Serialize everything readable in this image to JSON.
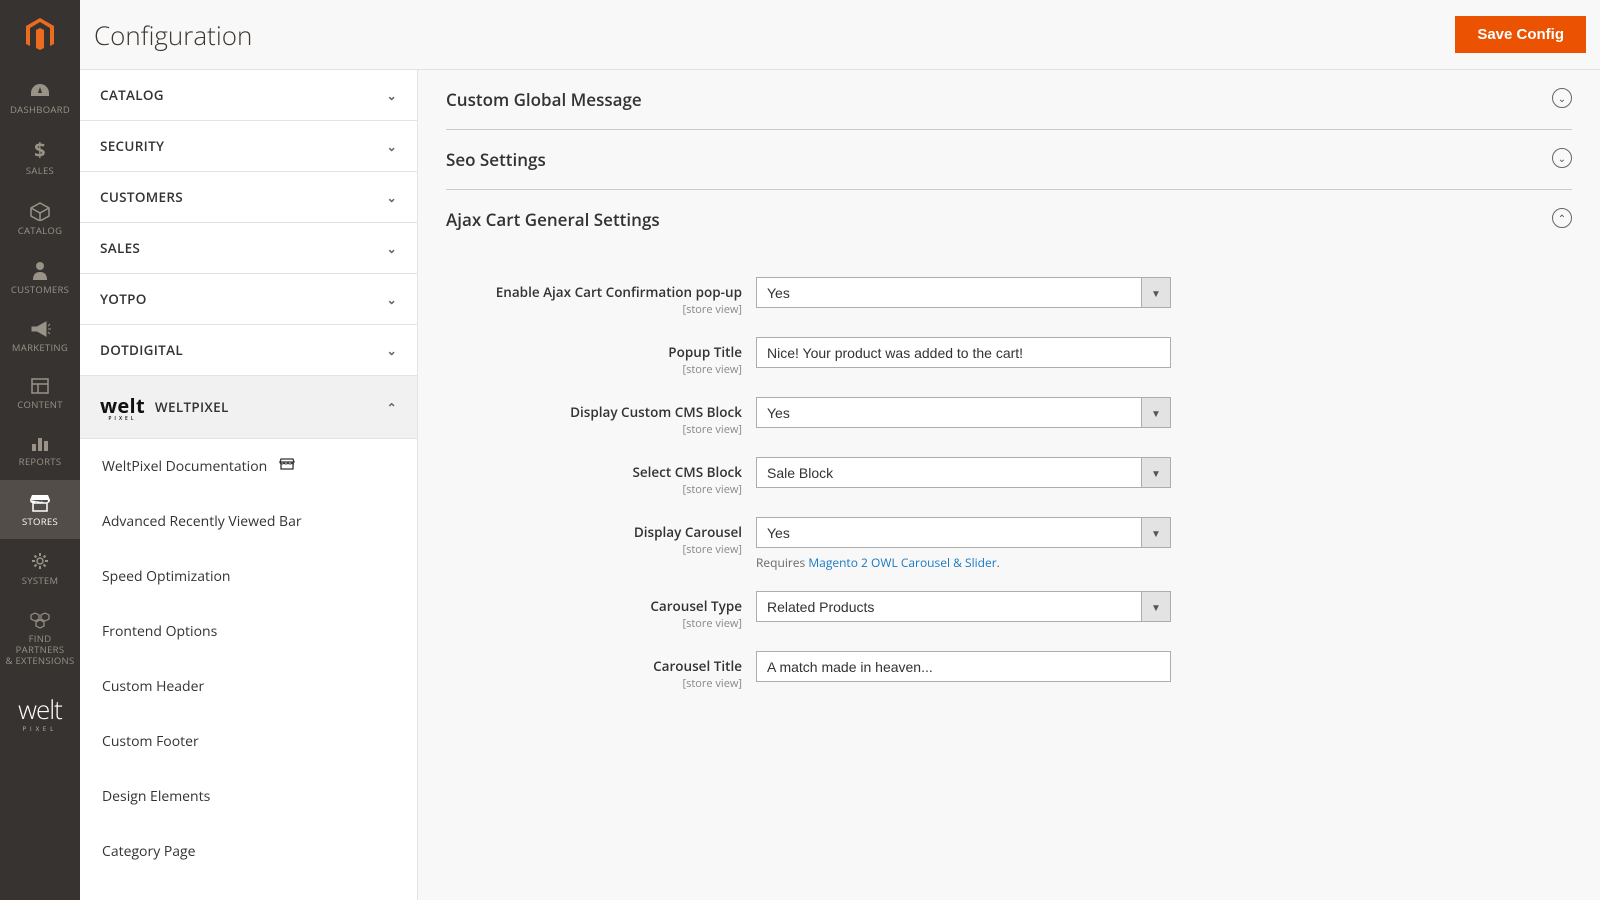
{
  "header": {
    "title": "Configuration",
    "save_label": "Save Config"
  },
  "admin_nav": {
    "items": [
      {
        "label": "DASHBOARD",
        "icon": "dashboard"
      },
      {
        "label": "SALES",
        "icon": "dollar"
      },
      {
        "label": "CATALOG",
        "icon": "cube"
      },
      {
        "label": "CUSTOMERS",
        "icon": "person"
      },
      {
        "label": "MARKETING",
        "icon": "megaphone"
      },
      {
        "label": "CONTENT",
        "icon": "blocks"
      },
      {
        "label": "REPORTS",
        "icon": "bars"
      },
      {
        "label": "STORES",
        "icon": "store",
        "active": true
      },
      {
        "label": "SYSTEM",
        "icon": "gear"
      },
      {
        "label": "FIND PARTNERS\n& EXTENSIONS",
        "icon": "boxes"
      }
    ]
  },
  "config_tabs": {
    "sections": [
      {
        "label": "CATALOG"
      },
      {
        "label": "SECURITY"
      },
      {
        "label": "CUSTOMERS"
      },
      {
        "label": "SALES"
      },
      {
        "label": "YOTPO"
      },
      {
        "label": "DOTDIGITAL"
      }
    ],
    "welt_section": "WELTPIXEL",
    "welt_items": [
      {
        "label": "WeltPixel Documentation",
        "has_icon": true
      },
      {
        "label": "Advanced Recently Viewed Bar"
      },
      {
        "label": "Speed Optimization"
      },
      {
        "label": "Frontend Options"
      },
      {
        "label": "Custom Header"
      },
      {
        "label": "Custom Footer"
      },
      {
        "label": "Design Elements"
      },
      {
        "label": "Category Page"
      }
    ]
  },
  "fieldsets": {
    "custom_message": "Custom Global Message",
    "seo": "Seo Settings",
    "ajax": "Ajax Cart General Settings"
  },
  "fields": {
    "enable_popup": {
      "label": "Enable Ajax Cart Confirmation pop-up",
      "scope": "[store view]",
      "value": "Yes"
    },
    "popup_title": {
      "label": "Popup Title",
      "scope": "[store view]",
      "value": "Nice! Your product was added to the cart!"
    },
    "display_cms": {
      "label": "Display Custom CMS Block",
      "scope": "[store view]",
      "value": "Yes"
    },
    "select_cms": {
      "label": "Select CMS Block",
      "scope": "[store view]",
      "value": "Sale Block"
    },
    "display_carousel": {
      "label": "Display Carousel",
      "scope": "[store view]",
      "value": "Yes",
      "hint_pre": "Requires ",
      "hint_link": "Magento 2 OWL Carousel & Slider",
      "hint_post": "."
    },
    "carousel_type": {
      "label": "Carousel Type",
      "scope": "[store view]",
      "value": "Related Products"
    },
    "carousel_title": {
      "label": "Carousel Title",
      "scope": "[store view]",
      "value": "A match made in heaven..."
    }
  }
}
